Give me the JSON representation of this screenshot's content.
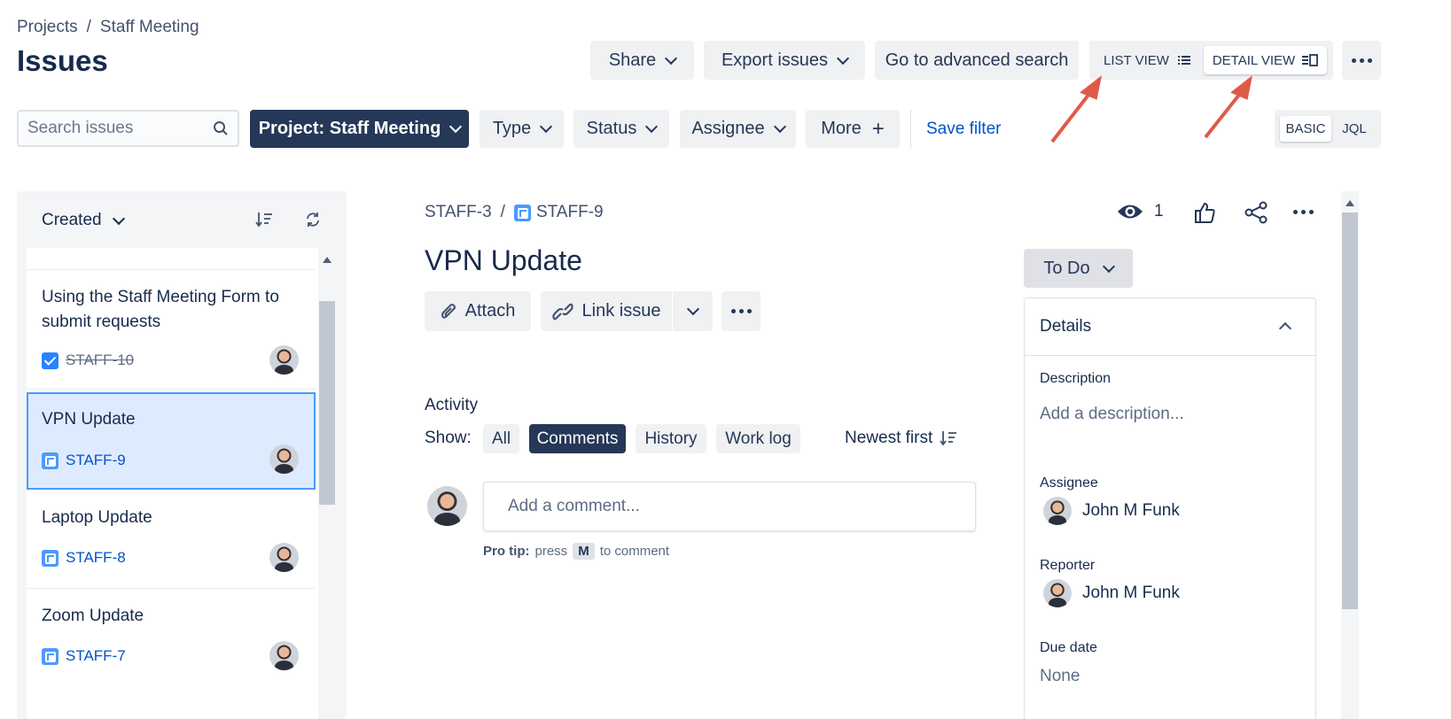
{
  "breadcrumb": {
    "projects": "Projects",
    "separator": "/",
    "project": "Staff Meeting"
  },
  "page_title": "Issues",
  "header_buttons": {
    "share": "Share",
    "export": "Export issues",
    "advanced_search": "Go to advanced search"
  },
  "view_toggle": {
    "list": "LIST VIEW",
    "detail": "DETAIL VIEW"
  },
  "filters": {
    "search_placeholder": "Search issues",
    "project": "Project: Staff Meeting",
    "type": "Type",
    "status": "Status",
    "assignee": "Assignee",
    "more": "More",
    "save_filter": "Save filter",
    "basic": "BASIC",
    "jql": "JQL"
  },
  "list": {
    "sort_label": "Created",
    "items": [
      {
        "title_line1": "Using the Staff Meeting Form to",
        "title_line2": "submit requests",
        "key": "STAFF-10",
        "done": true
      },
      {
        "title": "VPN Update",
        "key": "STAFF-9",
        "selected": true
      },
      {
        "title": "Laptop Update",
        "key": "STAFF-8"
      },
      {
        "title": "Zoom Update",
        "key": "STAFF-7"
      }
    ]
  },
  "issue": {
    "parent_key": "STAFF-3",
    "separator": "/",
    "key": "STAFF-9",
    "watchers": "1",
    "title": "VPN Update",
    "attach": "Attach",
    "link_issue": "Link issue",
    "status": "To Do"
  },
  "activity": {
    "heading": "Activity",
    "show_label": "Show:",
    "tabs": [
      "All",
      "Comments",
      "History",
      "Work log"
    ],
    "active_tab": "Comments",
    "sort": "Newest first",
    "comment_placeholder": "Add a comment...",
    "pro_tip_label": "Pro tip:",
    "pro_tip_press": "press",
    "pro_tip_key": "M",
    "pro_tip_rest": "to comment"
  },
  "details": {
    "heading": "Details",
    "description_label": "Description",
    "description_placeholder": "Add a description...",
    "assignee_label": "Assignee",
    "assignee": "John M Funk",
    "reporter_label": "Reporter",
    "reporter": "John M Funk",
    "due_label": "Due date",
    "due": "None"
  },
  "colors": {
    "brand_dark": "#253858",
    "link": "#0052cc",
    "annotation_arrow": "#e05a4a",
    "selected_bg": "#deebff"
  }
}
